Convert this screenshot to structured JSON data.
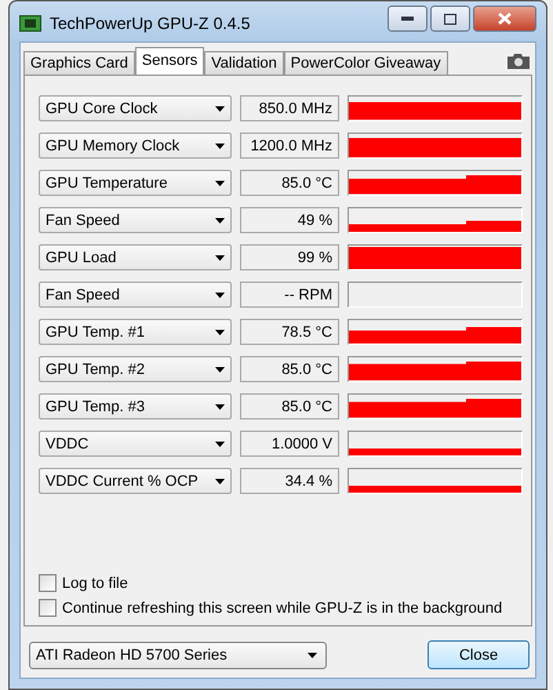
{
  "window": {
    "title": "TechPowerUp GPU-Z 0.4.5"
  },
  "tabs": [
    {
      "label": "Graphics Card",
      "selected": false
    },
    {
      "label": "Sensors",
      "selected": true
    },
    {
      "label": "Validation",
      "selected": false
    },
    {
      "label": "PowerColor Giveaway",
      "selected": false
    }
  ],
  "sensors": [
    {
      "name": "GPU Core Clock",
      "reading": "850.0 MHz"
    },
    {
      "name": "GPU Memory Clock",
      "reading": "1200.0 MHz"
    },
    {
      "name": "GPU Temperature",
      "reading": "85.0 °C"
    },
    {
      "name": "Fan Speed",
      "reading": "49 %"
    },
    {
      "name": "GPU Load",
      "reading": "99 %"
    },
    {
      "name": "Fan Speed",
      "reading": "-- RPM"
    },
    {
      "name": "GPU Temp. #1",
      "reading": "78.5 °C"
    },
    {
      "name": "GPU Temp. #2",
      "reading": "85.0 °C"
    },
    {
      "name": "GPU Temp. #3",
      "reading": "85.0 °C"
    },
    {
      "name": "VDDC",
      "reading": "1.0000 V"
    },
    {
      "name": "VDDC Current % OCP",
      "reading": "34.4 %"
    }
  ],
  "options": [
    {
      "label": "Log to file",
      "checked": false
    },
    {
      "label": "Continue refreshing this screen while GPU-Z is in the background",
      "checked": false
    }
  ],
  "device_select": {
    "value": "ATI Radeon HD 5700 Series"
  },
  "close_button": "Close"
}
